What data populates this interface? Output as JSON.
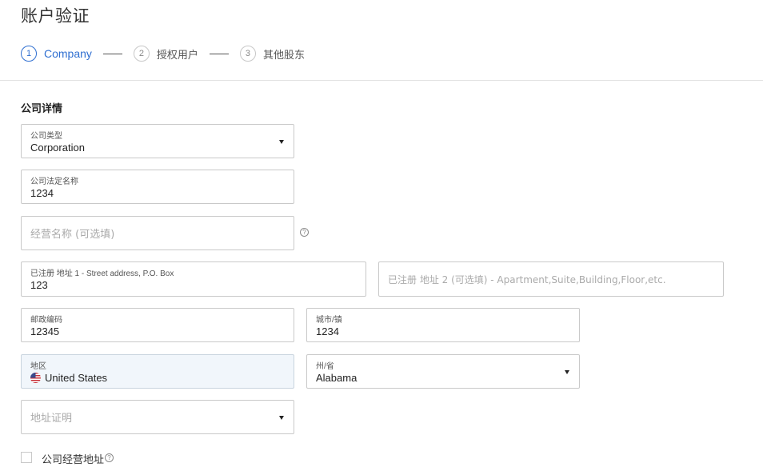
{
  "page": {
    "title": "账户验证"
  },
  "steps": [
    {
      "number": "1",
      "label": "Company",
      "active": true
    },
    {
      "number": "2",
      "label": "授权用户",
      "active": false
    },
    {
      "number": "3",
      "label": "其他股东",
      "active": false
    }
  ],
  "section": {
    "title": "公司详情"
  },
  "fields": {
    "company_type": {
      "label": "公司类型",
      "value": "Corporation"
    },
    "legal_name": {
      "label": "公司法定名称",
      "value": "1234"
    },
    "dba_name": {
      "placeholder": "经营名称 (可选填)"
    },
    "address1": {
      "label": "已注册 地址 1 - Street address, P.O. Box",
      "value": "123"
    },
    "address2": {
      "placeholder": "已注册 地址 2 (可选填) - Apartment,Suite,Building,Floor,etc."
    },
    "postal_code": {
      "label": "邮政编码",
      "value": "12345"
    },
    "city": {
      "label": "城市/镇",
      "value": "1234"
    },
    "region": {
      "label": "地区",
      "value": "United States"
    },
    "state": {
      "label": "州/省",
      "value": "Alabama"
    },
    "address_proof": {
      "placeholder": "地址证明"
    }
  },
  "checkbox": {
    "label": "公司经营地址",
    "checked": false
  },
  "icons": {
    "help": "?",
    "flag": "us-flag-icon"
  },
  "colors": {
    "accent": "#2f6fd1",
    "border": "#c9c9c9",
    "disabled_bg": "#f1f6fb"
  }
}
